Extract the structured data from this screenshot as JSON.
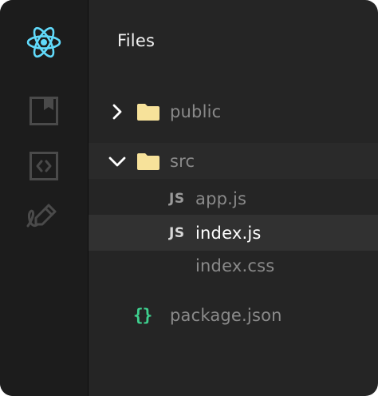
{
  "panel": {
    "title": "Files"
  },
  "sidebar": {
    "items": [
      {
        "icon": "react-logo-icon",
        "active": true,
        "color": "#61dafb"
      },
      {
        "icon": "bookmark-icon",
        "active": false
      },
      {
        "icon": "code-icon",
        "active": false
      },
      {
        "icon": "signature-pen-icon",
        "active": false
      }
    ]
  },
  "tree": {
    "public": {
      "name": "public",
      "expanded": false
    },
    "src": {
      "name": "src",
      "expanded": true
    },
    "app_js": {
      "type": "JS",
      "name": "app.js"
    },
    "index_js": {
      "type": "JS",
      "name": "index.js",
      "selected": true
    },
    "index_css": {
      "name": "index.css"
    },
    "package_json": {
      "type": "{}",
      "name": "package.json"
    }
  },
  "colors": {
    "background": "#252525",
    "sidebar": "#1c1c1c",
    "folder": "#f7e29a",
    "json_braces": "#3ecf8e",
    "accent": "#61dafb"
  }
}
